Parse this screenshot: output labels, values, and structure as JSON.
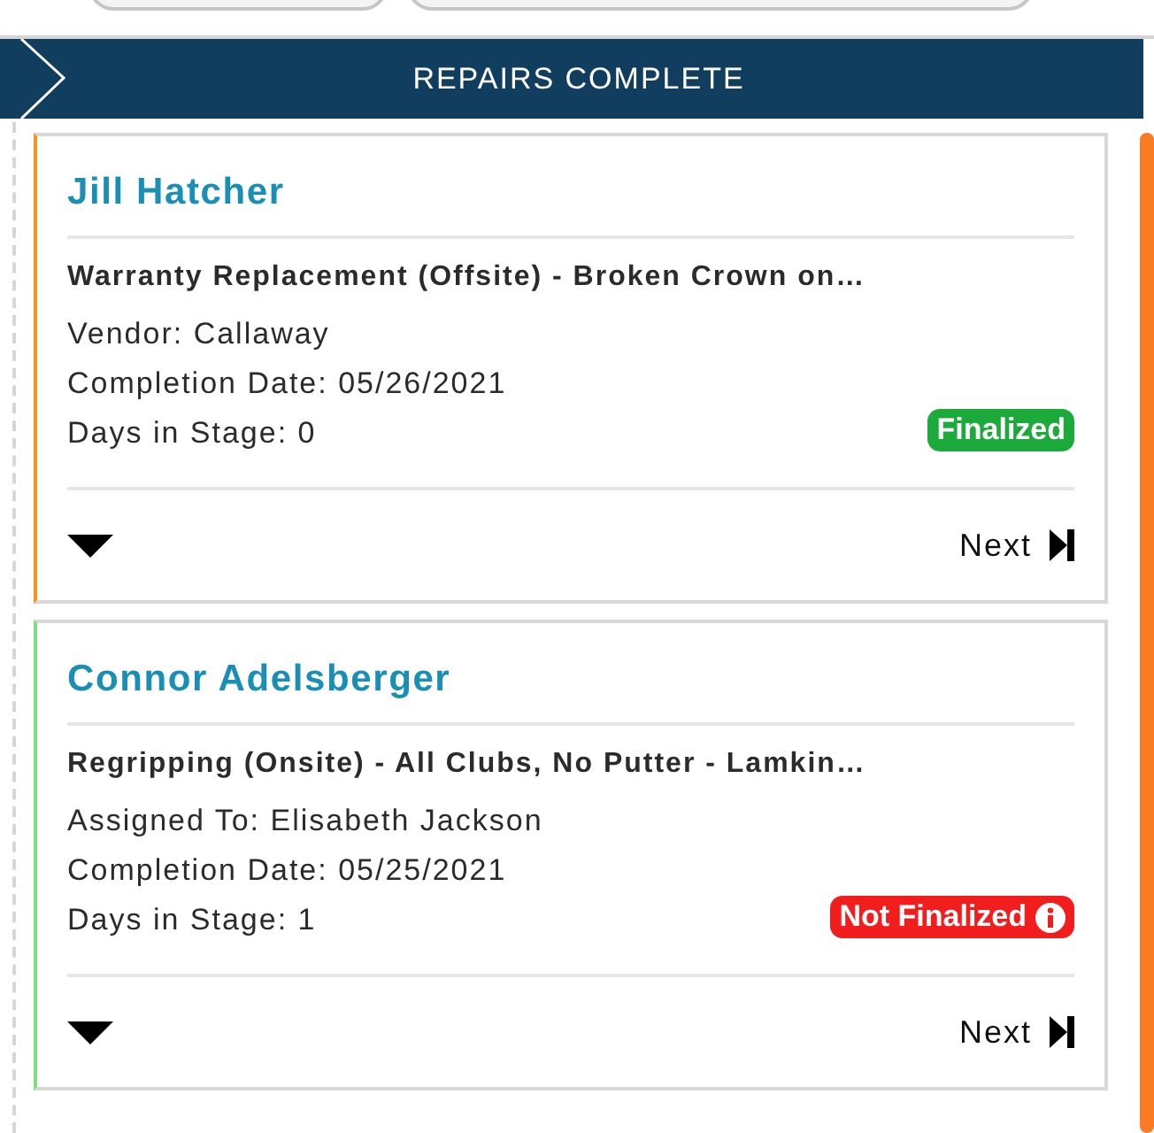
{
  "stage_header": {
    "title": "REPAIRS COMPLETE"
  },
  "cards": [
    {
      "name": "Jill Hatcher",
      "color": "#f7931e",
      "title": "Warranty Replacement (Offsite) - Broken Crown on…",
      "details": [
        "Vendor: Callaway",
        "Completion Date: 05/26/2021",
        "Days in Stage: 0"
      ],
      "status": {
        "label": "Finalized",
        "kind": "finalized"
      },
      "next": "Next"
    },
    {
      "name": "Connor Adelsberger",
      "color": "#7ee07e",
      "title": "Regripping (Onsite) - All Clubs, No Putter - Lamkin…",
      "details": [
        "Assigned To: Elisabeth Jackson",
        "Completion Date: 05/25/2021",
        "Days in Stage: 1"
      ],
      "status": {
        "label": "Not Finalized",
        "kind": "not_finalized"
      },
      "next": "Next"
    }
  ]
}
